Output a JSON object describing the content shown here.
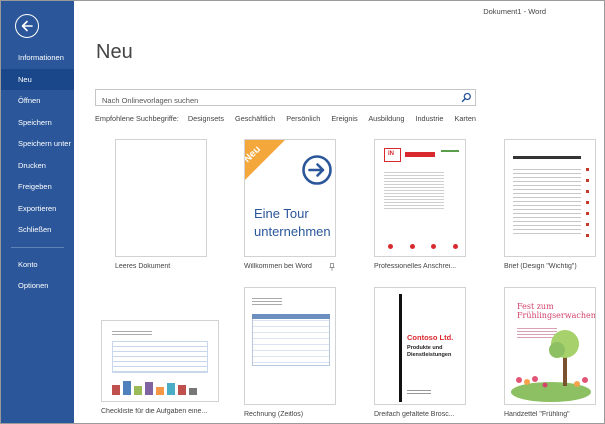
{
  "window": {
    "title": "Dokument1 - Word"
  },
  "sidebar": {
    "items": [
      {
        "label": "Informationen"
      },
      {
        "label": "Neu"
      },
      {
        "label": "Öffnen"
      },
      {
        "label": "Speichern"
      },
      {
        "label": "Speichern unter"
      },
      {
        "label": "Drucken"
      },
      {
        "label": "Freigeben"
      },
      {
        "label": "Exportieren"
      },
      {
        "label": "Schließen"
      },
      {
        "label": "Konto"
      },
      {
        "label": "Optionen"
      }
    ],
    "active": "Neu",
    "colors": {
      "bg": "#2b579a",
      "active": "#19478a"
    }
  },
  "main": {
    "title": "Neu",
    "search": {
      "placeholder": "Nach Onlinevorlagen suchen"
    },
    "suggestions": {
      "label": "Empfohlene Suchbegriffe:",
      "terms": [
        "Designsets",
        "Geschäftlich",
        "Persönlich",
        "Ereignis",
        "Ausbildung",
        "Industrie",
        "Karten"
      ]
    },
    "templates": [
      {
        "caption": "Leeres Dokument"
      },
      {
        "caption": "Willkommen bei Word",
        "badge": "Neu",
        "line1": "Eine Tour",
        "line2": "unternehmen"
      },
      {
        "caption": "Professionelles Anschrei...",
        "logo": "IN"
      },
      {
        "caption": "Brief (Design \"Wichtig\")"
      },
      {
        "caption": "Checkliste für die Aufgaben eine..."
      },
      {
        "caption": "Rechnung (Zeitlos)"
      },
      {
        "caption": "Dreifach gefaltete Brosc...",
        "heading": "Contoso Ltd.",
        "sub1": "Produkte und",
        "sub2": "Dienstleistungen"
      },
      {
        "caption": "Handzettel \"Frühling\"",
        "heading1": "Fest zum",
        "heading2": "Frühlingserwachen"
      }
    ]
  }
}
